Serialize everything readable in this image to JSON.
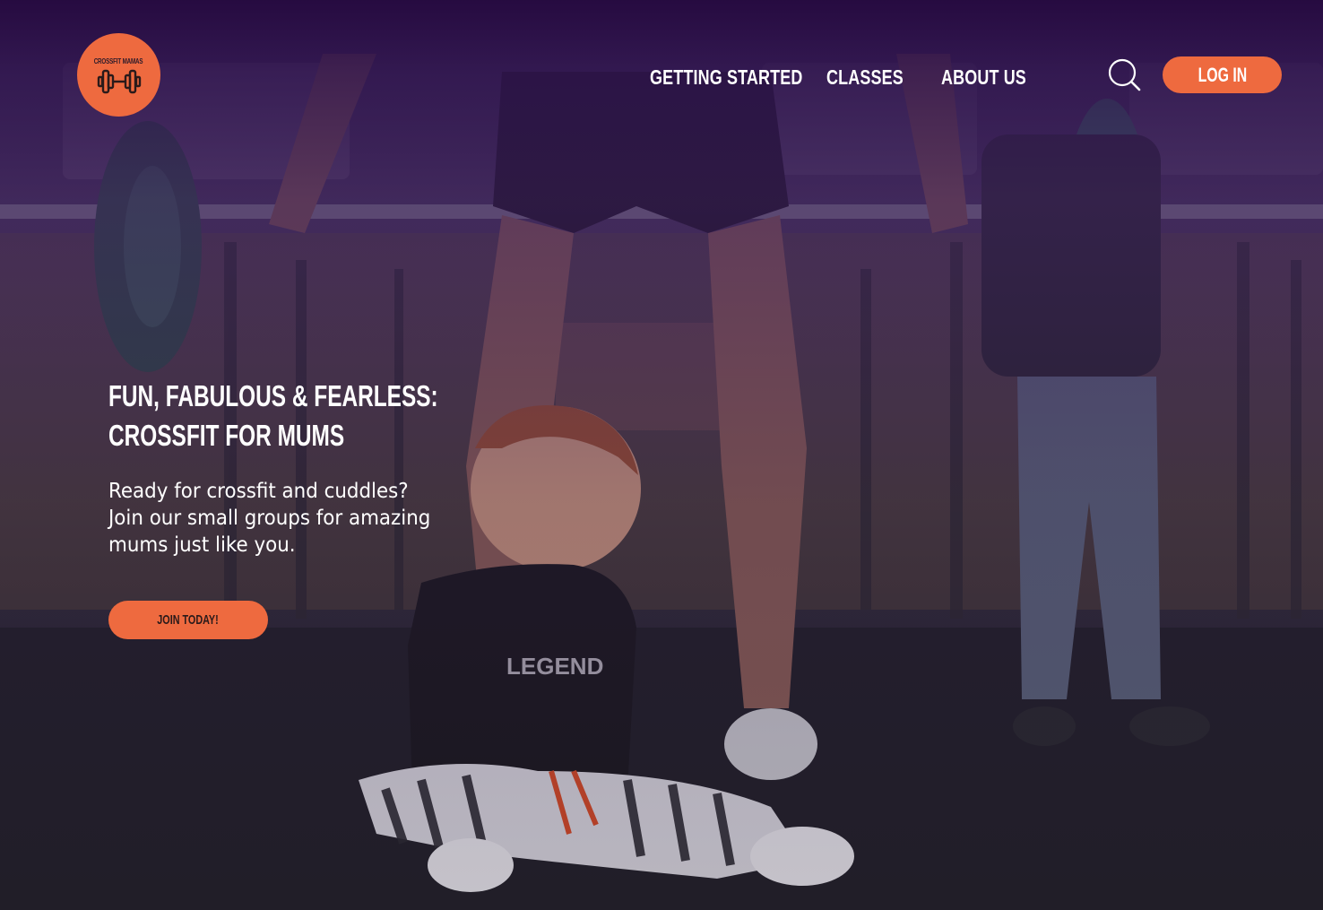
{
  "brand": {
    "logo_text": "CROSSFIT MAMAS",
    "logo_icon": "dumbbell-icon",
    "accent_color": "#ee6a3f"
  },
  "nav": {
    "items": [
      {
        "label": "GETTING STARTED"
      },
      {
        "label": "CLASSES"
      },
      {
        "label": "ABOUT US"
      }
    ],
    "search_icon": "search-icon",
    "login_label": "LOG IN"
  },
  "hero": {
    "title_line1": "FUN, FABULOUS & FEARLESS:",
    "title_line2": "CROSSFIT FOR MUMS",
    "subtitle": "Ready for crossfit and cuddles? Join our small groups for amazing mums just like you.",
    "cta_label": "JOIN TODAY!",
    "photo_description_icon": "hero-photo"
  }
}
